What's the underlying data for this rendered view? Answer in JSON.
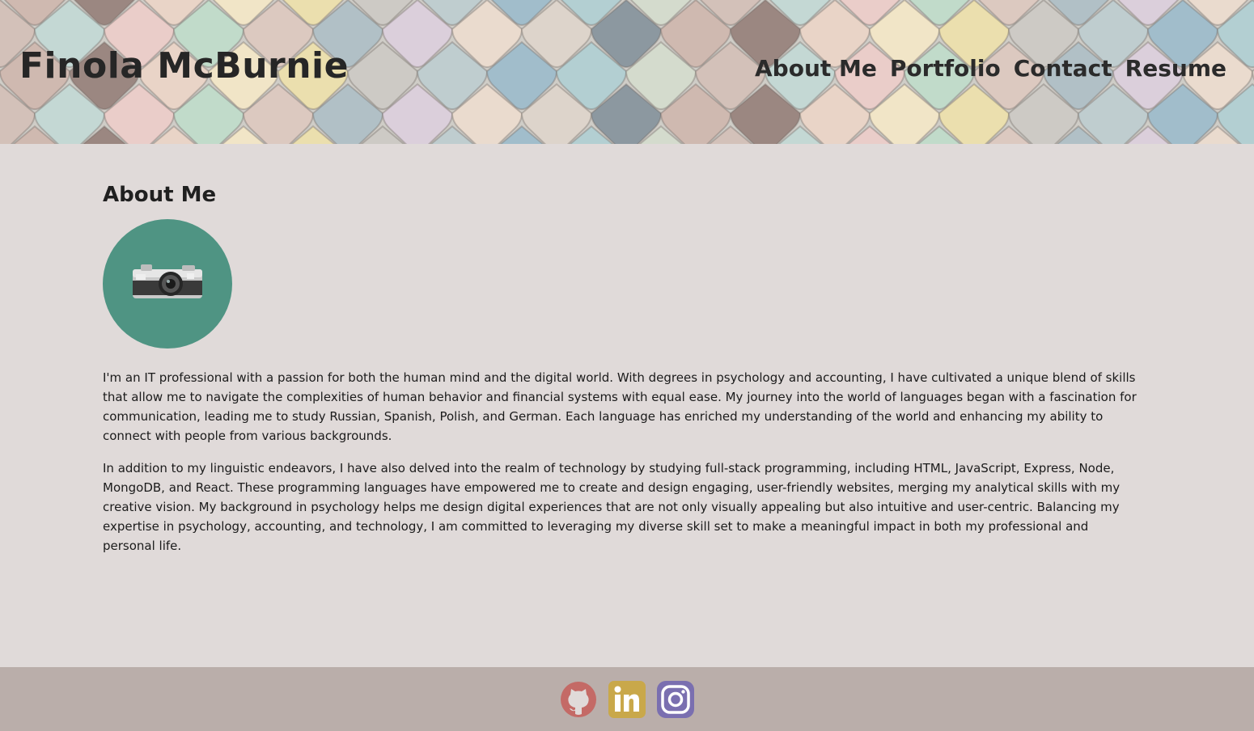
{
  "header": {
    "title": "Finola McBurnie",
    "nav": [
      "About Me",
      "Portfolio",
      "Contact",
      "Resume"
    ]
  },
  "about": {
    "heading": "About Me",
    "avatar_icon": "camera-icon",
    "paragraphs": [
      "I'm an IT professional with a passion for both the human mind and the digital world. With degrees in psychology and accounting, I have cultivated a unique blend of skills that allow me to navigate the complexities of human behavior and financial systems with equal ease. My journey into the world of languages began with a fascination for communication, leading me to study Russian, Spanish, Polish, and German. Each language has enriched my understanding of the world and enhancing my ability to connect with people from various backgrounds.",
      "In addition to my linguistic endeavors, I have also delved into the realm of technology by studying full-stack programming, including HTML, JavaScript, Express, Node, MongoDB, and React. These programming languages have empowered me to create and design engaging, user-friendly websites, merging my analytical skills with my creative vision. My background in psychology helps me design digital experiences that are not only visually appealing but also intuitive and user-centric. Balancing my expertise in psychology, accounting, and technology, I am committed to leveraging my diverse skill set to make a meaningful impact in both my professional and personal life."
    ]
  },
  "footer": {
    "links": [
      {
        "icon": "github-icon",
        "color": "#c46a66"
      },
      {
        "icon": "linkedin-icon",
        "color": "#c9a84a",
        "text": "in"
      },
      {
        "icon": "instagram-icon",
        "color": "#7a6fb0"
      }
    ]
  },
  "colors": {
    "background": "#e0dad9",
    "footer": "#baaeaa",
    "avatar_bg": "#4f9483"
  }
}
